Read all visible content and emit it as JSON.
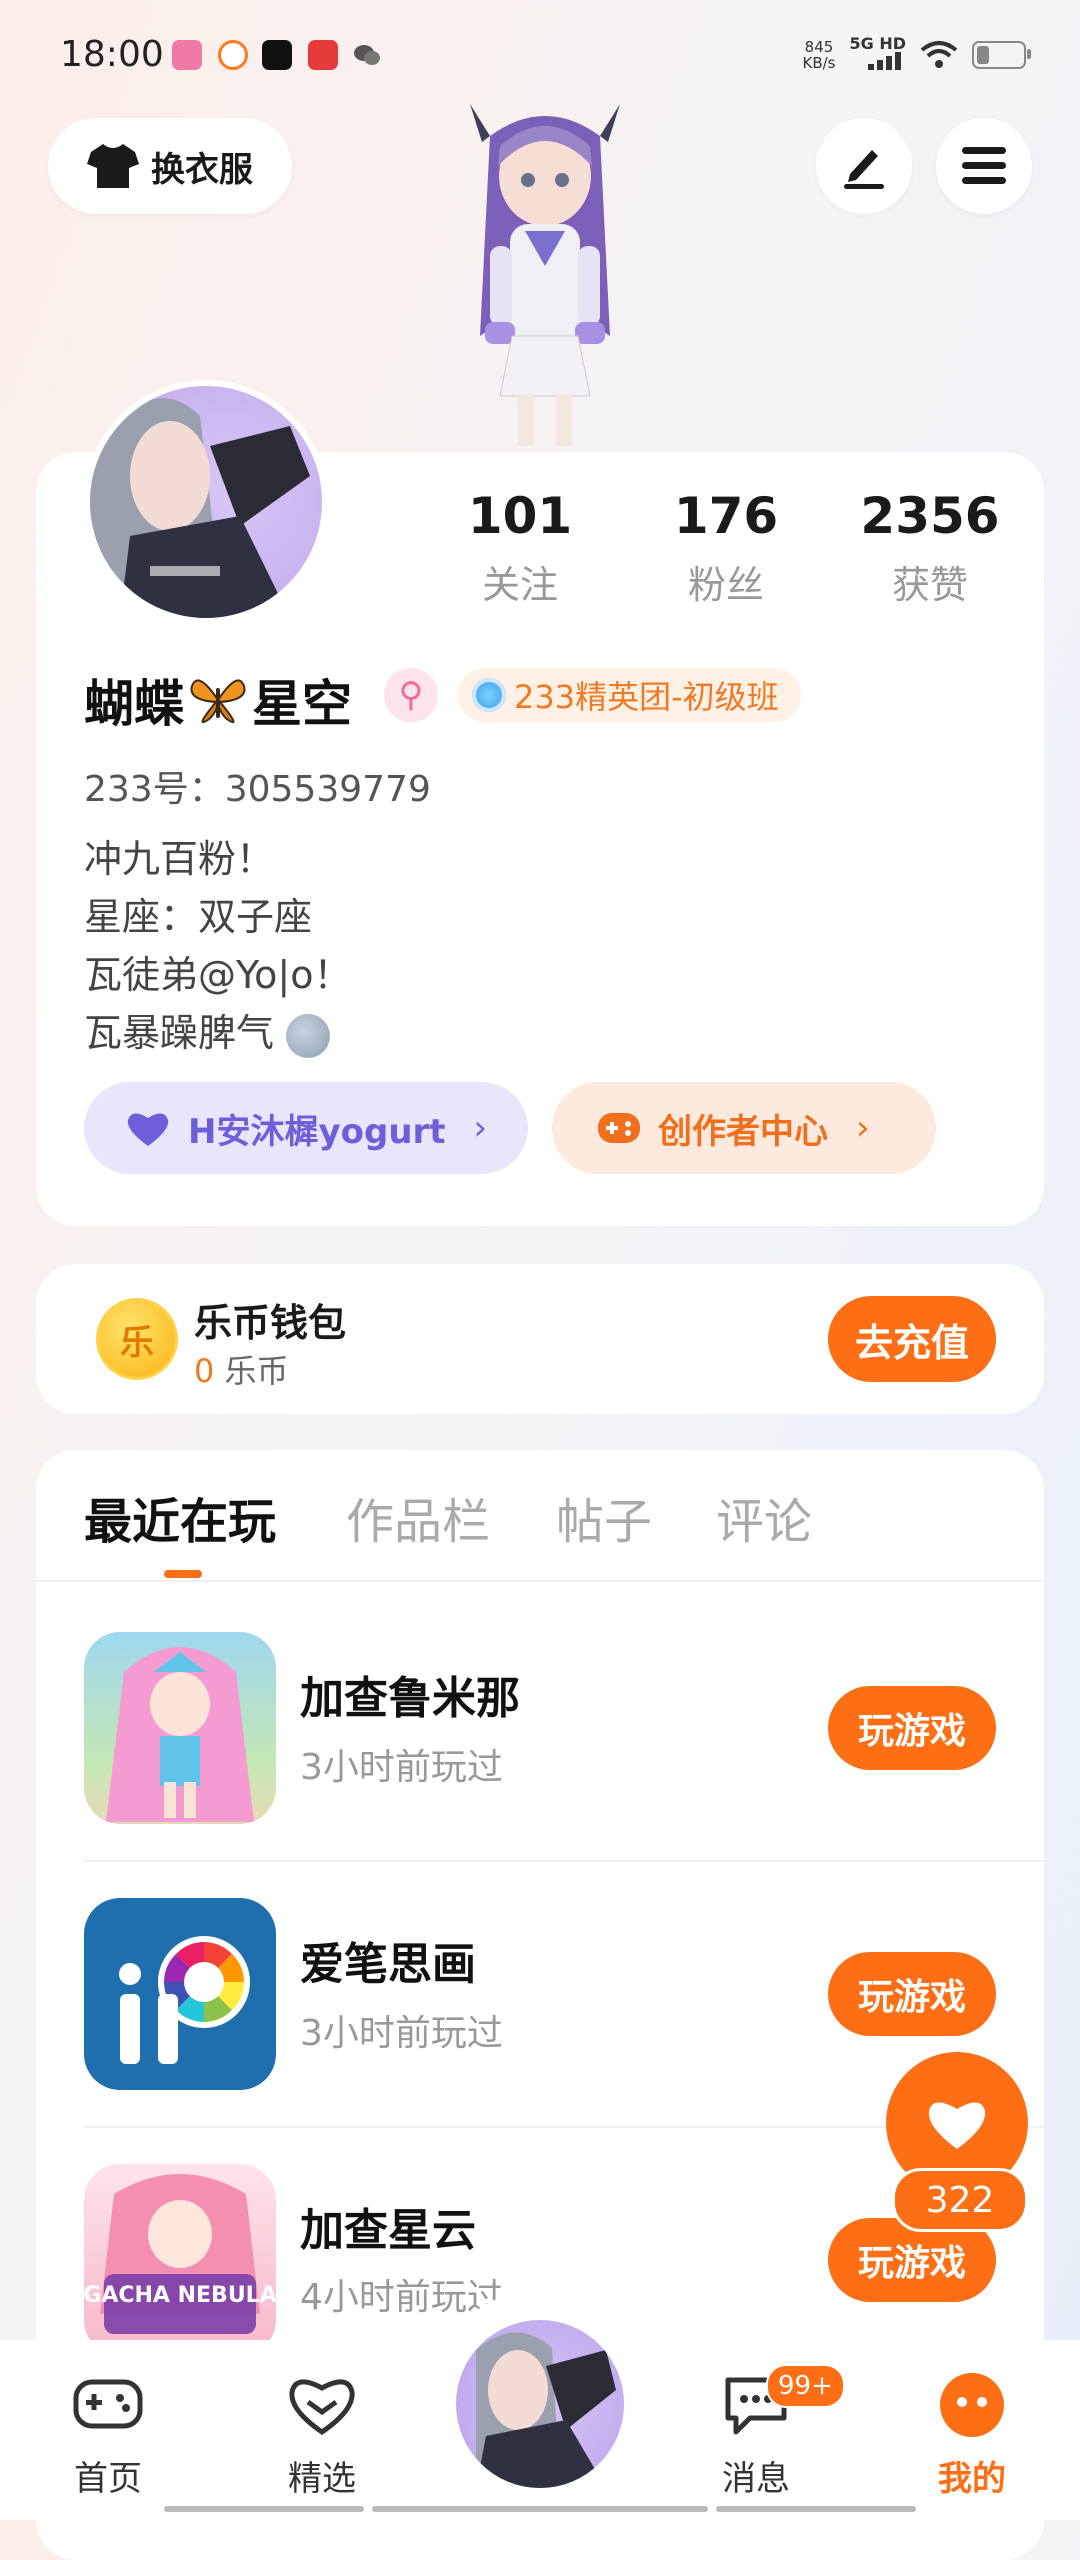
{
  "status_bar": {
    "time": "18:00",
    "net_speed_value": "845",
    "net_speed_unit": "KB/s",
    "signal_label": "5G HD"
  },
  "top": {
    "wardrobe_label": "换衣服"
  },
  "profile": {
    "following_count": "101",
    "following_label": "关注",
    "fans_count": "176",
    "fans_label": "粉丝",
    "likes_count": "2356",
    "likes_label": "获赞",
    "username_part1": "蝴蝶",
    "username_part2": "星空",
    "gender_symbol": "⚲",
    "group_badge": "233精英团-初级班",
    "user_id": "233号：305539779",
    "bio": [
      "冲九百粉！",
      "星座：双子座",
      "瓦徒弟@Yo|o！",
      "瓦暴躁脾气"
    ],
    "friend_chip": "H安沐樨yogurt",
    "creator_chip": "创作者中心",
    "chip_chevron": "›"
  },
  "wallet": {
    "title": "乐币钱包",
    "coin_glyph": "乐",
    "balance_value": "0",
    "balance_unit": "乐币",
    "recharge_label": "去充值"
  },
  "tabs": [
    "最近在玩",
    "作品栏",
    "帖子",
    "评论"
  ],
  "games": [
    {
      "title": "加查鲁米那",
      "last_played": "3小时前玩过",
      "play_label": "玩游戏"
    },
    {
      "title": "爱笔思画",
      "last_played": "3小时前玩过",
      "play_label": "玩游戏"
    },
    {
      "title": "加查星云",
      "last_played": "4小时前玩过",
      "play_label": "玩游戏",
      "icon_text": "GACHA NEBULA"
    }
  ],
  "like_fab": {
    "count": "322"
  },
  "bottom_nav": {
    "home": "首页",
    "featured": "精选",
    "messages": "消息",
    "messages_badge": "99+",
    "mine": "我的"
  },
  "colors": {
    "accent": "#fe6e14",
    "friend_chip_text": "#6c5fd9",
    "avatar_bg": "#c8b3ef"
  }
}
